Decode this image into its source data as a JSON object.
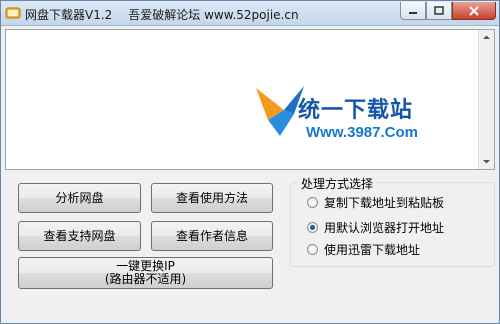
{
  "window": {
    "title": "网盘下载器V1.2",
    "subtitle": "吾爱破解论坛 www.52pojie.cn"
  },
  "webview": {
    "banner_title": "统一下载站",
    "banner_url": "Www.3987.Com"
  },
  "buttons": {
    "analyze": "分析网盘",
    "usage": "查看使用方法",
    "supported": "查看支持网盘",
    "author": "查看作者信息",
    "change_ip_line1": "一键更换IP",
    "change_ip_line2": "(路由器不适用)"
  },
  "options": {
    "legend": "处理方式选择",
    "items": [
      {
        "label": "复制下载地址到粘贴板",
        "checked": false
      },
      {
        "label": "用默认浏览器打开地址",
        "checked": true
      },
      {
        "label": "使用迅雷下载地址",
        "checked": false
      }
    ]
  },
  "colors": {
    "banner_title": "#1457a9",
    "banner_url": "#1778cf",
    "close_button": "#c7412c"
  }
}
